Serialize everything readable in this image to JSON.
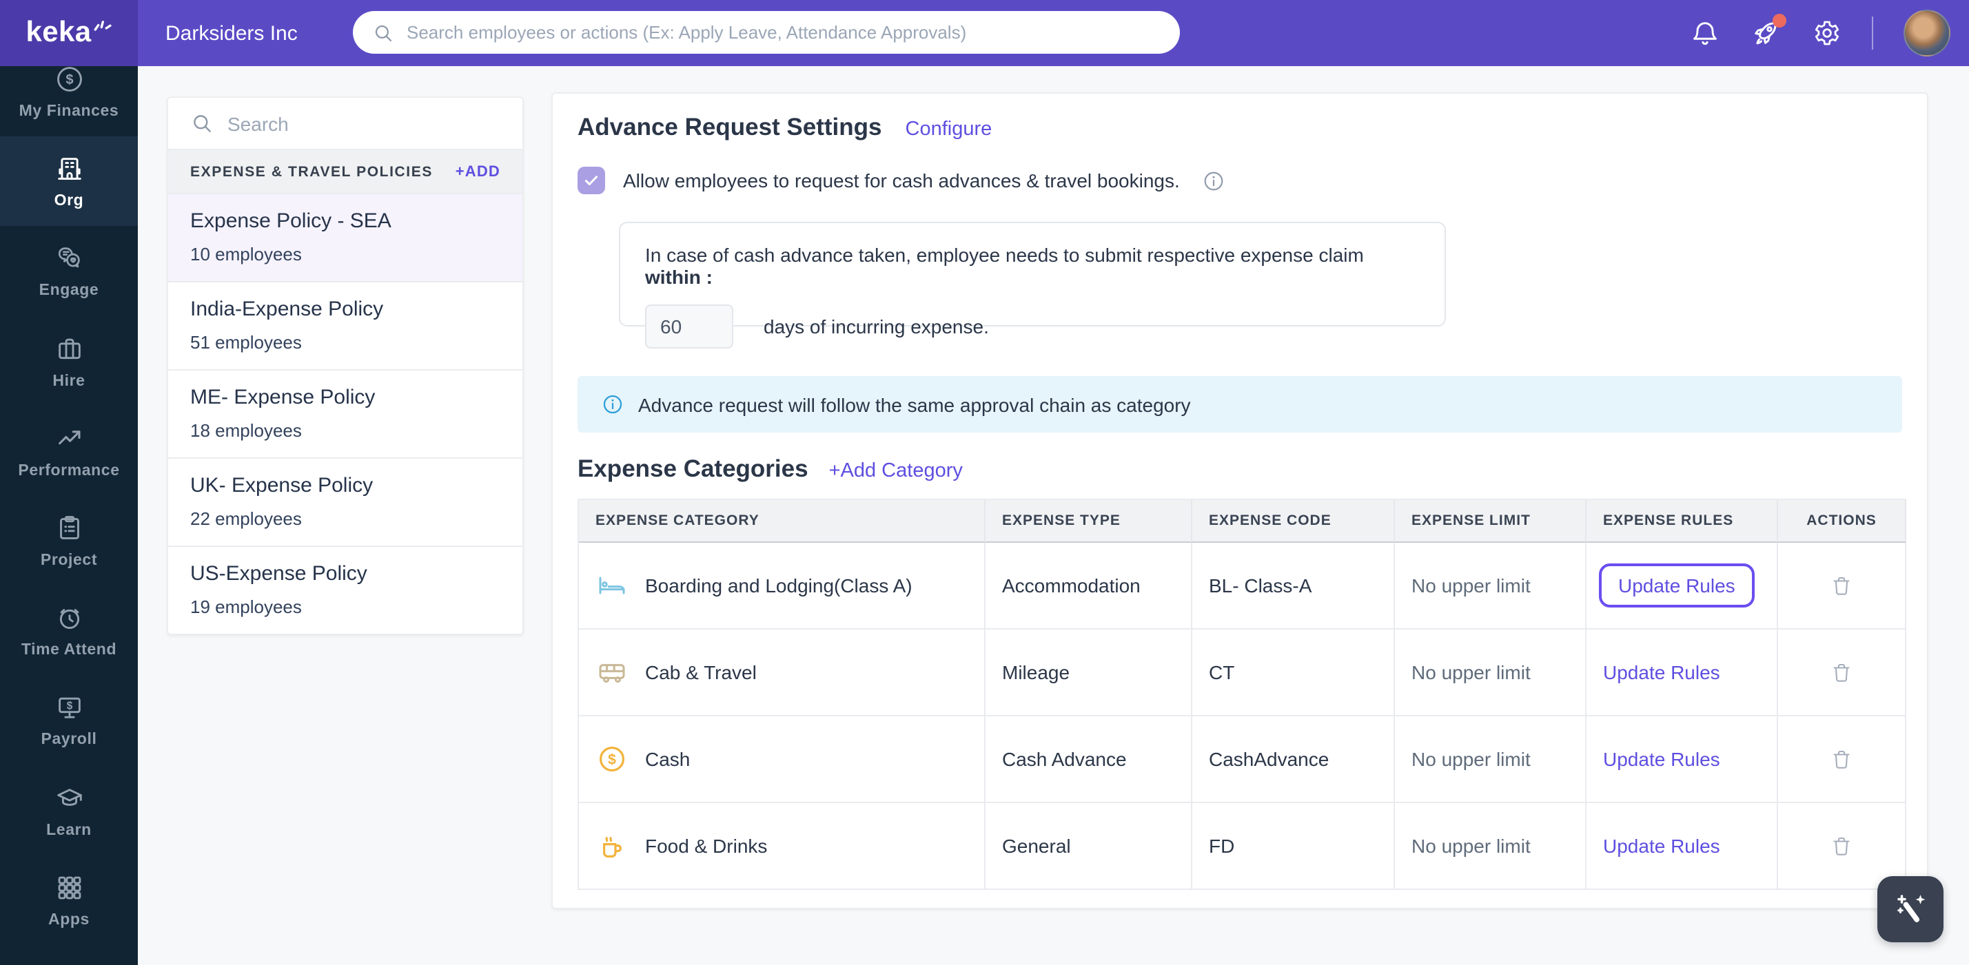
{
  "colors": {
    "topbar_purple": "#5A4BC5",
    "logo_block_purple": "#4B3AA9",
    "sidebar_navy": "#112433",
    "sidebar_active_navy": "#1C3145",
    "accent_purple": "#5E4FE0",
    "focus_ring_purple": "#6B4EF0",
    "checkbox_purple": "#A99FE2",
    "info_banner_bg": "#E6F4FB",
    "info_banner_icon_blue": "#2E9FD9",
    "notification_red": "#ED6A5E",
    "bed_icon_blue": "#7CC5E2",
    "van_icon_tan": "#C9B896",
    "coin_icon_gold": "#F2B33D"
  },
  "topbar": {
    "brand": "keka",
    "company": "Darksiders Inc",
    "search_placeholder": "Search employees or actions (Ex: Apply Leave, Attendance Approvals)",
    "icons": [
      "bell-icon",
      "rocket-icon",
      "gear-icon"
    ]
  },
  "sidebar": {
    "items": [
      {
        "label": "My Finances",
        "icon": "finance"
      },
      {
        "label": "Org",
        "icon": "org",
        "active": true
      },
      {
        "label": "Engage",
        "icon": "engage"
      },
      {
        "label": "Hire",
        "icon": "hire"
      },
      {
        "label": "Performance",
        "icon": "performance"
      },
      {
        "label": "Project",
        "icon": "project"
      },
      {
        "label": "Time Attend",
        "icon": "time"
      },
      {
        "label": "Payroll",
        "icon": "payroll"
      },
      {
        "label": "Learn",
        "icon": "learn"
      },
      {
        "label": "Apps",
        "icon": "apps"
      }
    ]
  },
  "policies_panel": {
    "search_placeholder": "Search",
    "section_title": "EXPENSE & TRAVEL POLICIES",
    "add_label": "+ADD",
    "items": [
      {
        "name": "Expense Policy - SEA",
        "employees": "10 employees",
        "selected": true
      },
      {
        "name": "India-Expense Policy",
        "employees": "51 employees"
      },
      {
        "name": "ME- Expense Policy",
        "employees": "18 employees"
      },
      {
        "name": "UK- Expense Policy",
        "employees": "22 employees"
      },
      {
        "name": "US-Expense Policy",
        "employees": "19 employees"
      }
    ]
  },
  "advance_settings": {
    "title": "Advance Request Settings",
    "configure_label": "Configure",
    "allow_checkbox_label": "Allow employees to request for cash advances & travel bookings.",
    "claim_text": "In case of cash advance taken, employee needs to submit respective expense claim",
    "claim_text_bold": "within :",
    "days_value": "60",
    "days_suffix": "days of incurring expense.",
    "info_banner": "Advance request will follow the same approval chain as category"
  },
  "expense_categories": {
    "title": "Expense Categories",
    "add_label": "+Add Category",
    "columns": [
      "EXPENSE CATEGORY",
      "EXPENSE TYPE",
      "EXPENSE CODE",
      "EXPENSE LIMIT",
      "EXPENSE RULES",
      "ACTIONS"
    ],
    "rows": [
      {
        "icon": "bed-icon",
        "category": "Boarding and Lodging(Class A)",
        "type": "Accommodation",
        "code": "BL- Class-A",
        "limit": "No upper limit",
        "rules_label": "Update Rules",
        "focused": true
      },
      {
        "icon": "van-icon",
        "category": "Cab & Travel",
        "type": "Mileage",
        "code": "CT",
        "limit": "No upper limit",
        "rules_label": "Update Rules"
      },
      {
        "icon": "coin-icon",
        "category": "Cash",
        "type": "Cash Advance",
        "code": "CashAdvance",
        "limit": "No upper limit",
        "rules_label": "Update Rules"
      },
      {
        "icon": "mug-icon",
        "category": "Food & Drinks",
        "type": "General",
        "code": "FD",
        "limit": "No upper limit",
        "rules_label": "Update Rules"
      }
    ]
  }
}
